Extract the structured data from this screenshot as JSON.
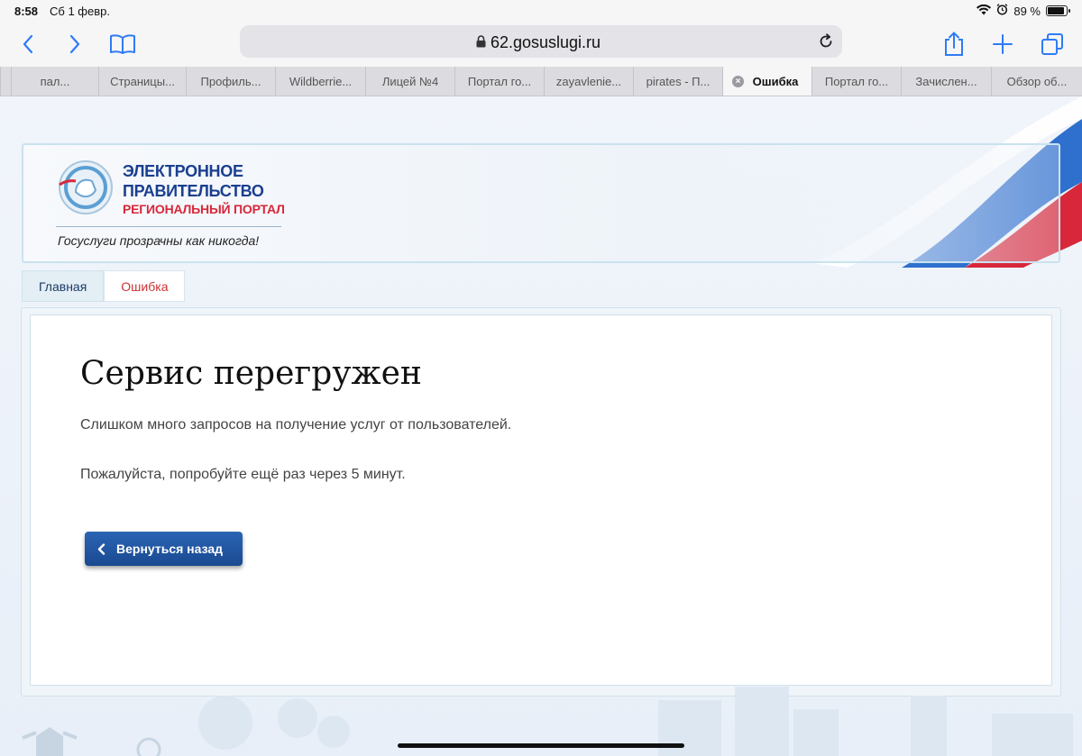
{
  "status_bar": {
    "time": "8:58",
    "date": "Сб 1 февр.",
    "battery": "89 %",
    "battery_level": 0.89
  },
  "browser": {
    "url": "62.gosuslugi.ru",
    "icons": [
      "back-icon",
      "forward-icon",
      "bookmarks-icon",
      "lock-icon",
      "reload-icon",
      "share-icon",
      "new-tab-icon",
      "tabs-icon"
    ],
    "tabs": [
      {
        "label": "пал..."
      },
      {
        "label": "Страницы..."
      },
      {
        "label": "Профиль..."
      },
      {
        "label": "Wildberrie..."
      },
      {
        "label": "Лицей №4"
      },
      {
        "label": "Портал го..."
      },
      {
        "label": "zayavlenie..."
      },
      {
        "label": "pirates - П..."
      },
      {
        "label": "Ошибка",
        "active": true
      },
      {
        "label": "Портал го..."
      },
      {
        "label": "Зачислен..."
      },
      {
        "label": "Обзор об..."
      }
    ]
  },
  "header": {
    "logo_line1": "ЭЛЕКТРОННОЕ",
    "logo_line2": "ПРАВИТЕЛЬСТВО",
    "logo_line3": "РЕГИОНАЛЬНЫЙ ПОРТАЛ",
    "tagline": "Госуслуги прозрачны как никогда!",
    "colors": {
      "blue": "#1a3f8f",
      "red": "#d8273a"
    }
  },
  "breadcrumbs": [
    {
      "label": "Главная"
    },
    {
      "label": "Ошибка"
    }
  ],
  "content": {
    "title": "Сервис перегружен",
    "message1": "Слишком много запросов на получение услуг от пользователей.",
    "message2": "Пожалуйста, попробуйте ещё раз через 5 минут.",
    "back_button": "Вернуться назад",
    "button_color": "#1f55a3"
  }
}
